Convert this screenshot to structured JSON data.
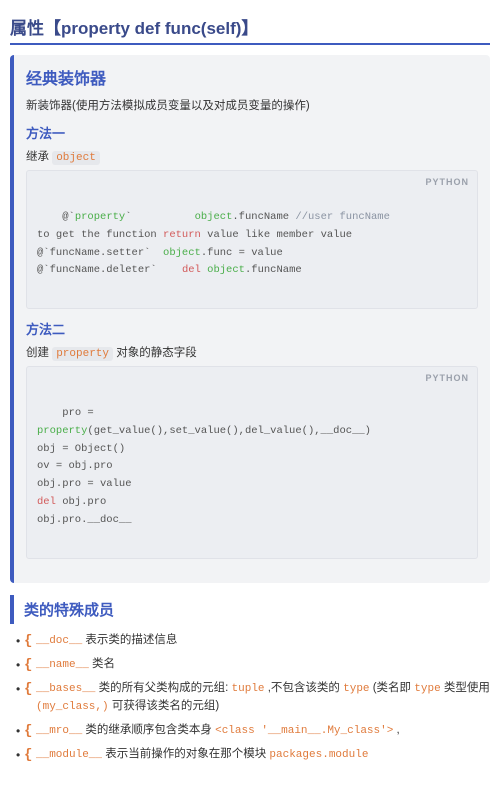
{
  "header": {
    "title": "属性【property def func(self)】"
  },
  "card": {
    "title": "经典装饰器",
    "desc": "新装饰器(使用方法模拟成员变量以及对成员变量的操作)",
    "method1": {
      "title": "方法一",
      "intro_prefix": "继承 ",
      "intro_kw": "object",
      "lang": "PYTHON",
      "code": [
        {
          "t": "@`",
          "c": ""
        },
        {
          "t": "property",
          "c": "tok-green"
        },
        {
          "t": "`          ",
          "c": ""
        },
        {
          "t": "object",
          "c": "tok-green"
        },
        {
          "t": ".funcName ",
          "c": ""
        },
        {
          "t": "//user funcName",
          "c": "tok-cmt"
        },
        {
          "t": "\n",
          "c": ""
        },
        {
          "t": "to get the function ",
          "c": ""
        },
        {
          "t": "return",
          "c": "tok-red"
        },
        {
          "t": " value like member value\n",
          "c": ""
        },
        {
          "t": "@`funcName.setter`  ",
          "c": ""
        },
        {
          "t": "object",
          "c": "tok-green"
        },
        {
          "t": ".func = value\n",
          "c": ""
        },
        {
          "t": "@`funcName.deleter`    ",
          "c": ""
        },
        {
          "t": "del",
          "c": "tok-red"
        },
        {
          "t": " ",
          "c": ""
        },
        {
          "t": "object",
          "c": "tok-green"
        },
        {
          "t": ".funcName",
          "c": ""
        }
      ]
    },
    "method2": {
      "title": "方法二",
      "intro_prefix": "创建 ",
      "intro_kw": "property",
      "intro_suffix": " 对象的静态字段",
      "lang": "PYTHON",
      "code": [
        {
          "t": "pro =\n",
          "c": ""
        },
        {
          "t": "property",
          "c": "tok-green"
        },
        {
          "t": "(get_value(),set_value(),del_value(),__doc__)\n",
          "c": ""
        },
        {
          "t": "obj = Object()\n",
          "c": ""
        },
        {
          "t": "ov = obj.pro\n",
          "c": ""
        },
        {
          "t": "obj.pro = value\n",
          "c": ""
        },
        {
          "t": "del",
          "c": "tok-red"
        },
        {
          "t": " obj.pro\n",
          "c": ""
        },
        {
          "t": "obj.pro.__doc__",
          "c": ""
        }
      ]
    }
  },
  "section2": {
    "title": "类的特殊成员",
    "items": [
      [
        {
          "t": "__doc__",
          "c": "mono-orange"
        },
        {
          "t": " 表示类的描述信息",
          "c": ""
        }
      ],
      [
        {
          "t": "__name__",
          "c": "mono-orange"
        },
        {
          "t": " 类名",
          "c": ""
        }
      ],
      [
        {
          "t": "__bases__",
          "c": "mono-orange"
        },
        {
          "t": " 类的所有父类构成的元组: ",
          "c": ""
        },
        {
          "t": "tuple",
          "c": "mono-orange"
        },
        {
          "t": " ,不包含该类的 ",
          "c": ""
        },
        {
          "t": "type",
          "c": "mono-orange"
        },
        {
          "t": " (类名即 ",
          "c": ""
        },
        {
          "t": "type",
          "c": "mono-orange"
        },
        {
          "t": " 类型使用 ",
          "c": ""
        },
        {
          "t": "(my_class,)",
          "c": "mono-orange"
        },
        {
          "t": " 可获得该类名的元组)",
          "c": ""
        }
      ],
      [
        {
          "t": "__mro__",
          "c": "mono-orange"
        },
        {
          "t": " 类的继承顺序包含类本身 ",
          "c": ""
        },
        {
          "t": "<class '__main__.My_class'>",
          "c": "mono-orange"
        },
        {
          "t": " ,",
          "c": ""
        }
      ],
      [
        {
          "t": "__module__",
          "c": "mono-orange"
        },
        {
          "t": " 表示当前操作的对象在那个模块 ",
          "c": ""
        },
        {
          "t": "packages.module",
          "c": "mono-orange"
        }
      ]
    ]
  }
}
